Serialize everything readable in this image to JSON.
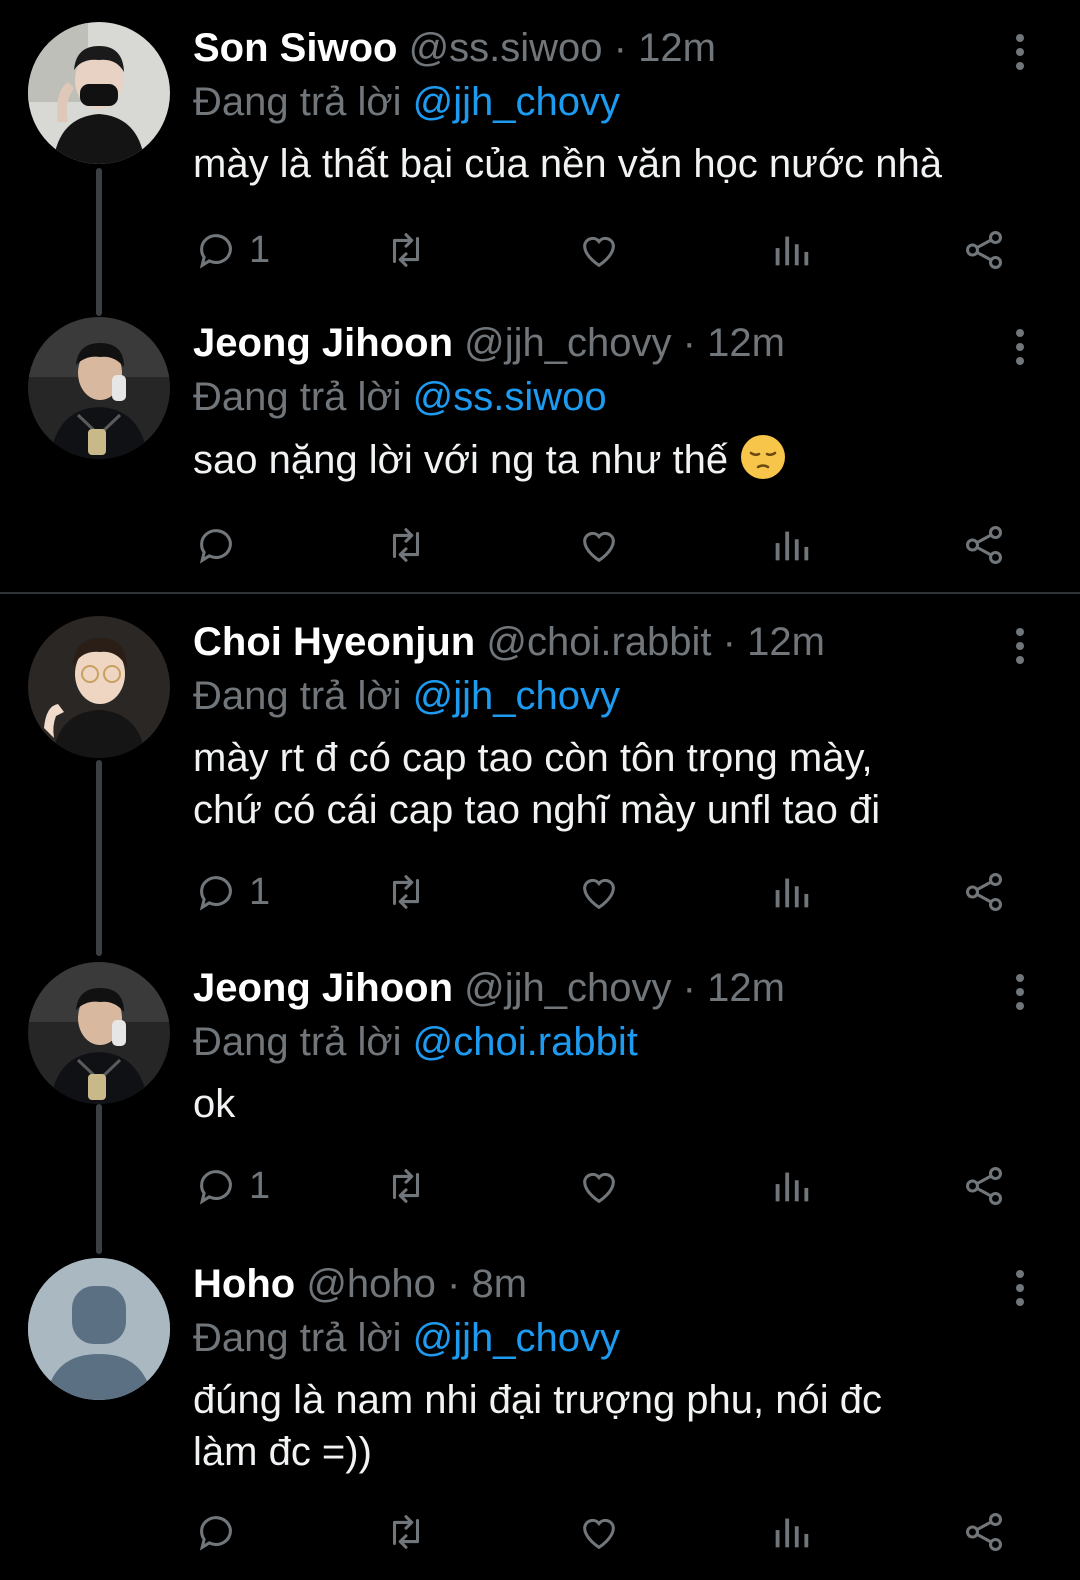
{
  "reply_prefix": "Đang trả lời",
  "separator": "·",
  "colors": {
    "background": "#000000",
    "mention": "#1d9bf0",
    "muted": "#71767b"
  },
  "tweets": [
    {
      "name": "Son Siwoo",
      "handle": "@ss.siwoo",
      "time": "12m",
      "reply_to": "@jjh_chovy",
      "text_lines": [
        "mày là thất bại của nền văn học nước nhà"
      ],
      "reply_count": "1",
      "avatar": "photo"
    },
    {
      "name": "Jeong Jihoon",
      "handle": "@jjh_chovy",
      "time": "12m",
      "reply_to": "@ss.siwoo",
      "text_lines": [
        "sao nặng lời với ng ta như thế"
      ],
      "emoji": "pensive-face",
      "reply_count": "",
      "avatar": "photo"
    },
    {
      "name": "Choi Hyeonjun",
      "handle": "@choi.rabbit",
      "time": "12m",
      "reply_to": "@jjh_chovy",
      "text_lines": [
        "mày rt đ có cap tao còn tôn trọng mày,",
        "chứ có cái cap tao nghĩ mày unfl tao đi"
      ],
      "reply_count": "1",
      "avatar": "photo"
    },
    {
      "name": "Jeong Jihoon",
      "handle": "@jjh_chovy",
      "time": "12m",
      "reply_to": "@choi.rabbit",
      "text_lines": [
        "ok"
      ],
      "reply_count": "1",
      "avatar": "photo"
    },
    {
      "name": "Hoho",
      "handle": "@hoho",
      "time": "8m",
      "reply_to": "@jjh_chovy",
      "text_lines": [
        "đúng là nam nhi đại trượng phu, nói đc",
        "làm đc =))"
      ],
      "reply_count": "",
      "avatar": "default-profile-icon"
    }
  ]
}
